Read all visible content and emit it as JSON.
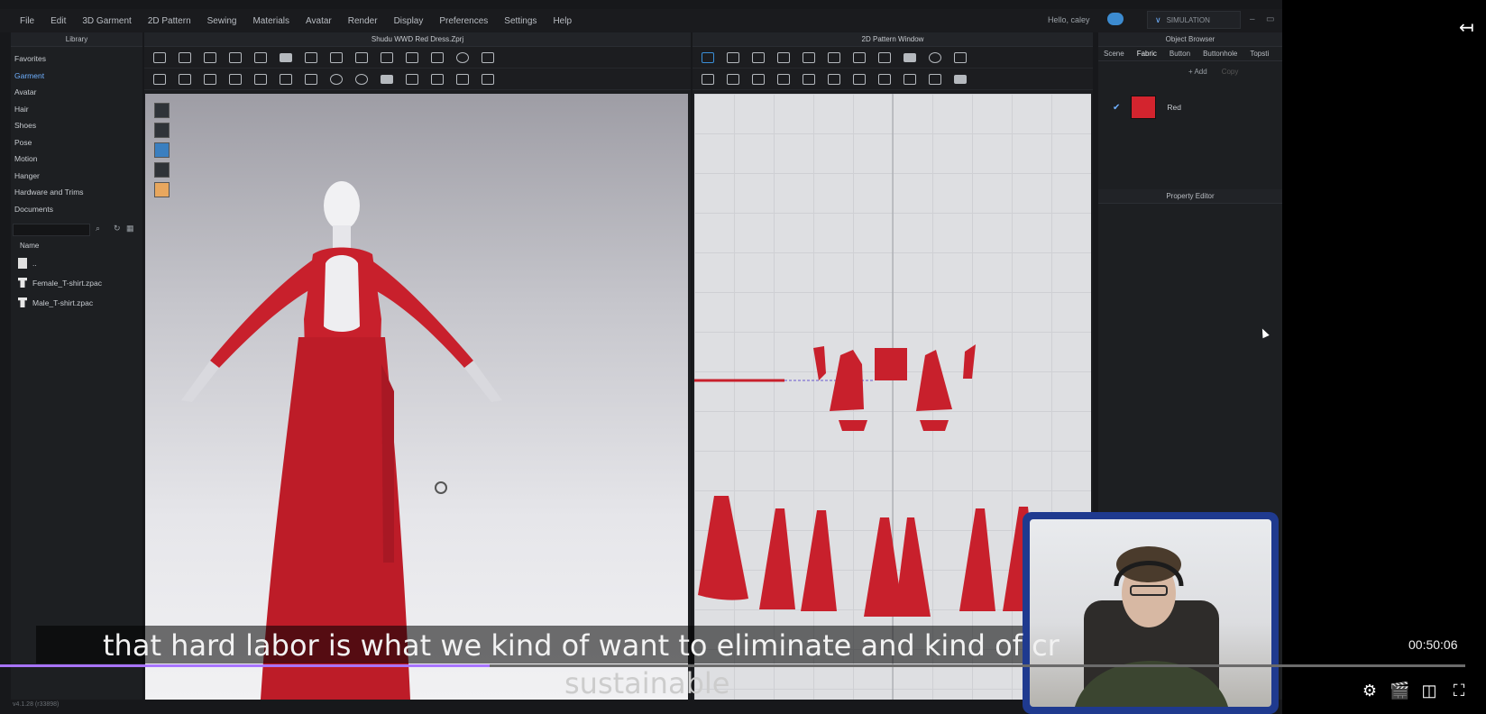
{
  "app": {
    "menu": [
      "File",
      "Edit",
      "3D Garment",
      "2D Pattern",
      "Sewing",
      "Materials",
      "Avatar",
      "Render",
      "Display",
      "Preferences",
      "Settings",
      "Help"
    ],
    "greeting": "Hello, caley",
    "mode": "SIMULATION",
    "version": "v4.1.28 (r33898)"
  },
  "library": {
    "title": "Library",
    "items": [
      "Favorites",
      "Garment",
      "Avatar",
      "Hair",
      "Shoes",
      "Pose",
      "Motion",
      "Hanger",
      "Hardware and Trims",
      "Documents"
    ],
    "active_item": "Garment",
    "name_header": "Name",
    "files": [
      "..",
      "Female_T-shirt.zpac",
      "Male_T-shirt.zpac"
    ]
  },
  "window3d": {
    "title": "Shudu WWD Red Dress.Zprj"
  },
  "window2d": {
    "title": "2D Pattern Window"
  },
  "object_browser": {
    "title": "Object Browser",
    "tabs": [
      "Scene",
      "Fabric",
      "Button",
      "Buttonhole",
      "Topsti"
    ],
    "active_tab": "Fabric",
    "actions": [
      "+ Add",
      "Copy"
    ],
    "fabric": {
      "name": "Red",
      "color": "#d3242e"
    },
    "property_editor_title": "Property Editor"
  },
  "player": {
    "subtitle_line1": "that hard labor is what we kind of want to eliminate and kind of cr",
    "subtitle_line2": "sustainable",
    "timecode": "00:50:06",
    "progress": 0.334
  },
  "colors": {
    "garment_red": "#c8202c",
    "accent": "#a874ff"
  },
  "icons": [
    "settings-icon",
    "clapperboard-icon",
    "theater-mode-icon",
    "fullscreen-icon",
    "collapse-panel-icon"
  ]
}
